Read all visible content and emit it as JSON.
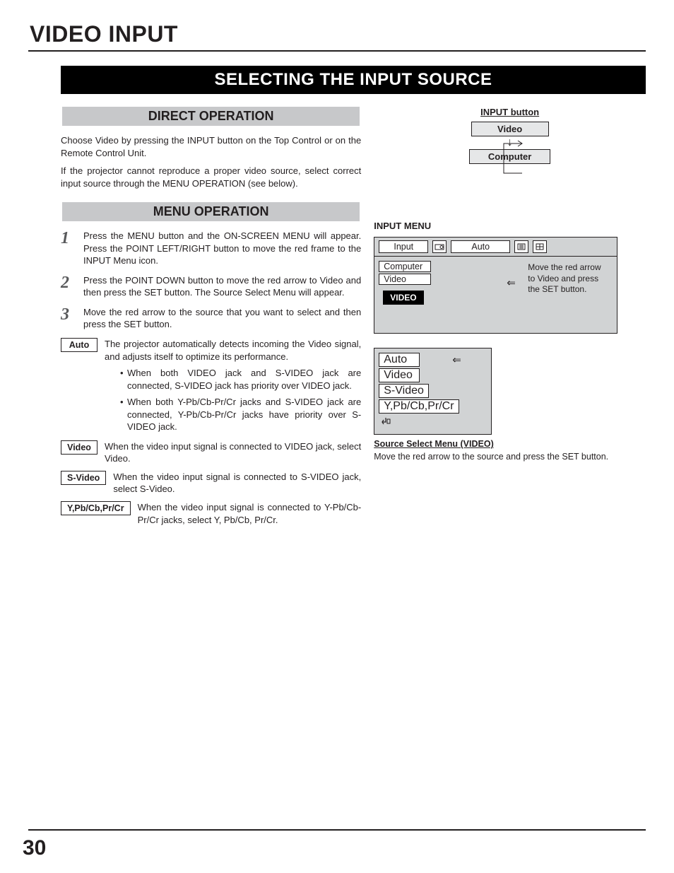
{
  "page_title": "VIDEO INPUT",
  "banner": "SELECTING THE INPUT SOURCE",
  "direct_operation": {
    "heading": "DIRECT OPERATION",
    "p1": "Choose Video by pressing the INPUT button on the Top Control or on the Remote Control Unit.",
    "p2": "If the projector cannot reproduce a proper video source, select correct input source through the MENU OPERATION (see below)."
  },
  "menu_operation": {
    "heading": "MENU OPERATION",
    "steps": [
      "Press the MENU button and the ON-SCREEN MENU will appear.  Press the POINT LEFT/RIGHT button to move the red frame to the INPUT Menu icon.",
      "Press the POINT DOWN button to move the red arrow to Video and then press the SET button.  The Source Select Menu will appear.",
      "Move the red arrow to the source that you want to select and then press the SET button."
    ],
    "options": {
      "auto": {
        "label": "Auto",
        "text": "The projector automatically detects incoming the Video signal, and adjusts itself to optimize its performance.",
        "bullets": [
          "When both VIDEO jack and S-VIDEO jack are connected, S-VIDEO jack has priority over VIDEO jack.",
          "When both Y-Pb/Cb-Pr/Cr jacks and S-VIDEO jack are connected, Y-Pb/Cb-Pr/Cr jacks have priority over S-VIDEO jack."
        ]
      },
      "video": {
        "label": "Video",
        "text": "When the video input signal is connected to VIDEO jack, select Video."
      },
      "svideo": {
        "label": "S-Video",
        "text": "When the video input signal is connected to S-VIDEO jack, select S-Video."
      },
      "ypbcb": {
        "label": "Y,Pb/Cb,Pr/Cr",
        "text": "When the video input signal is connected to Y-Pb/Cb-Pr/Cr jacks, select Y, Pb/Cb, Pr/Cr."
      }
    }
  },
  "right": {
    "flow_title": "INPUT button",
    "flow_items": [
      "Video",
      "Computer"
    ],
    "input_menu_title": "INPUT MENU",
    "osd_top_label": "Input",
    "osd_top_mode": "Auto",
    "osd_list": [
      "Computer",
      "Video"
    ],
    "osd_note": "Move the red arrow to Video and press the SET button.",
    "badge": "VIDEO",
    "osd2_list": [
      "Auto",
      "Video",
      "S-Video",
      "Y,Pb/Cb,Pr/Cr"
    ],
    "source_title": "Source Select Menu (VIDEO)",
    "source_text": "Move the red arrow to the source and press the SET button."
  },
  "page_number": "30"
}
